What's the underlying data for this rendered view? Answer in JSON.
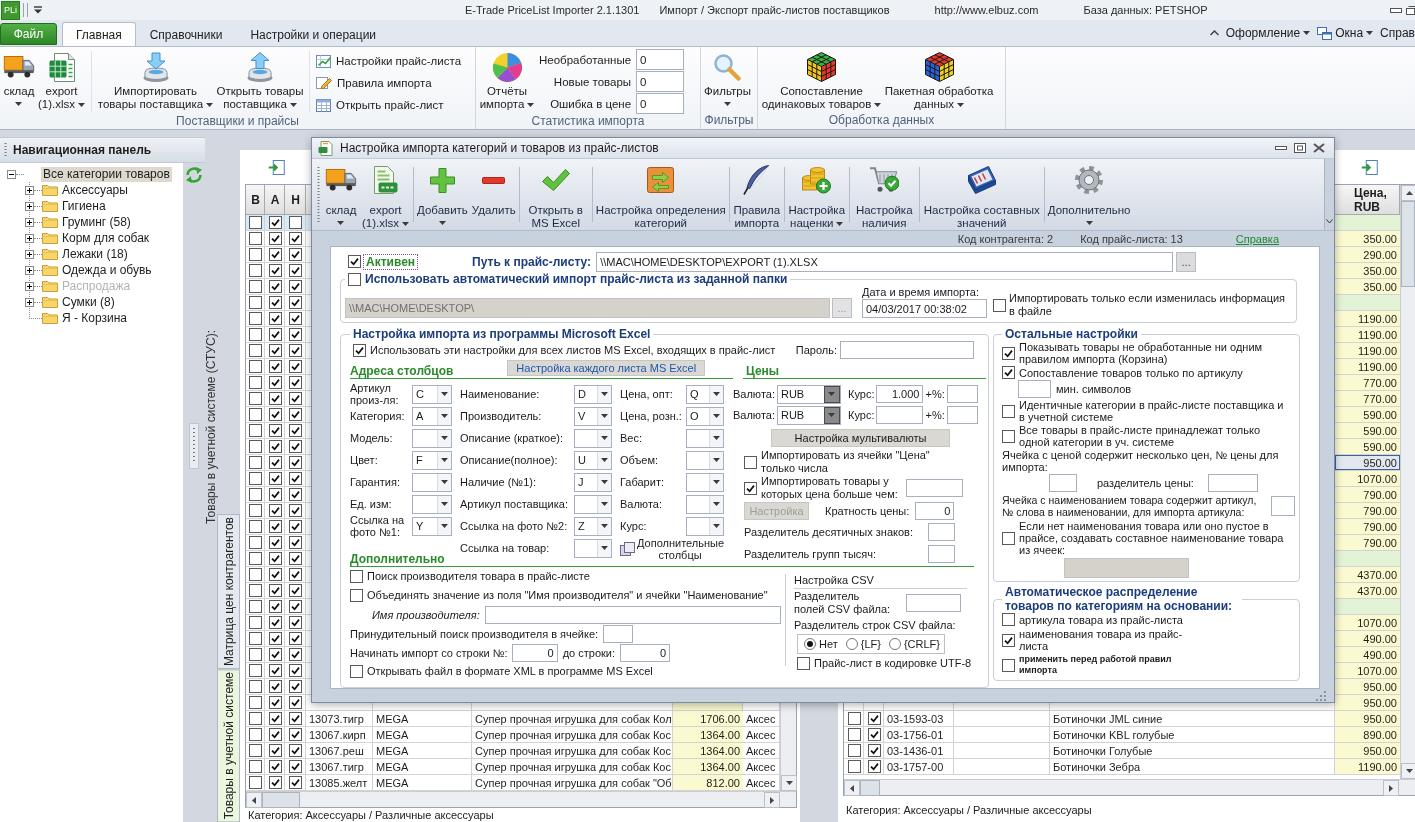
{
  "title_bar": {
    "logo": "PLi",
    "texts": [
      "E-Trade PriceList Importer 2.1.1301",
      "Импорт / Экспорт прайс-листов поставщиков",
      "http://www.elbuz.com",
      "База данных: PETSHOP"
    ]
  },
  "menu_tabs": [
    {
      "label": "Файл",
      "kind": "file",
      "selected": false
    },
    {
      "label": "Главная",
      "kind": "tab",
      "selected": true
    },
    {
      "label": "Справочники",
      "kind": "tab",
      "selected": false
    },
    {
      "label": "Настройки и операции",
      "kind": "tab",
      "selected": false
    }
  ],
  "menu_right": [
    {
      "label": "Оформление",
      "dropdown": true
    },
    {
      "label": "Окна",
      "dropdown": true
    },
    {
      "label": "Справ",
      "dropdown": false
    }
  ],
  "ribbon": {
    "groups": [
      {
        "label": "Поставщики и прайсы",
        "buttons": [
          {
            "label": "склад",
            "dropdown": true
          },
          {
            "label": "export (1).xlsx",
            "dropdown": true
          },
          {
            "label": "Импортировать товары поставщика",
            "dropdown": true
          },
          {
            "label": "Открыть товары поставщика",
            "dropdown": true
          }
        ],
        "small_buttons": [
          "Настройки прайс-листа",
          "Правила импорта",
          "Открыть прайс-лист"
        ]
      },
      {
        "label": "Статистика импорта",
        "buttons": [
          {
            "label": "Отчёты импорта",
            "dropdown": true
          }
        ],
        "stats": [
          {
            "label": "Необработанные",
            "value": "0"
          },
          {
            "label": "Новые товары",
            "value": "0"
          },
          {
            "label": "Ошибка в цене",
            "value": "0"
          }
        ]
      },
      {
        "label": "Фильтры",
        "buttons": [
          {
            "label": "Фильтры",
            "dropdown": true
          }
        ]
      },
      {
        "label": "Обработка данных",
        "buttons": [
          {
            "label": "Сопоставление одинаковых товаров",
            "dropdown": true
          },
          {
            "label": "Пакетная обработка данных",
            "dropdown": true
          }
        ]
      }
    ]
  },
  "navigation": {
    "title": "Навигационная панель",
    "tree": [
      {
        "label": "Все категории товаров",
        "selected": true,
        "disabled": false,
        "expanded": true,
        "children": [
          {
            "label": "Аксессуары",
            "selected": false,
            "disabled": false,
            "expanded": false
          },
          {
            "label": "Гигиена",
            "selected": false,
            "disabled": false,
            "expanded": false
          },
          {
            "label": "Груминг (58)",
            "selected": false,
            "disabled": false,
            "expanded": false
          },
          {
            "label": "Корм для собак",
            "selected": false,
            "disabled": false,
            "expanded": false
          },
          {
            "label": "Лежаки (18)",
            "selected": false,
            "disabled": false,
            "expanded": false
          },
          {
            "label": "Одежда и обувь",
            "selected": false,
            "disabled": false,
            "expanded": false
          },
          {
            "label": "Распродажа",
            "selected": false,
            "disabled": true,
            "expanded": false
          },
          {
            "label": "Сумки (8)",
            "selected": false,
            "disabled": false,
            "expanded": false
          },
          {
            "label": "Я - Корзина",
            "selected": false,
            "disabled": false
          }
        ]
      }
    ]
  },
  "workspace": {
    "caption": "Товары в учетной системе (СТУС):",
    "side_tabs": [
      {
        "label": "Матрица цен контрагентов",
        "selected": false
      },
      {
        "label": "Товары в учетной системе",
        "selected": true
      }
    ]
  },
  "left_grid": {
    "columns": [
      "В",
      "А",
      "Н"
    ],
    "rows": [
      {
        "selected": true,
        "b": false,
        "a": true,
        "h": false
      },
      {
        "selected": false,
        "b": false,
        "a": true,
        "h": true
      },
      {
        "selected": false,
        "b": false,
        "a": true,
        "h": true
      },
      {
        "selected": false,
        "b": false,
        "a": true,
        "h": true
      },
      {
        "selected": false,
        "b": false,
        "a": true,
        "h": true
      },
      {
        "selected": false,
        "b": false,
        "a": true,
        "h": true
      },
      {
        "selected": false,
        "b": false,
        "a": true,
        "h": true
      },
      {
        "selected": false,
        "b": false,
        "a": true,
        "h": true
      },
      {
        "selected": false,
        "b": false,
        "a": true,
        "h": true
      },
      {
        "selected": false,
        "b": false,
        "a": true,
        "h": true
      },
      {
        "selected": false,
        "b": false,
        "a": true,
        "h": true
      },
      {
        "selected": false,
        "b": false,
        "a": true,
        "h": true
      },
      {
        "selected": false,
        "b": false,
        "a": true,
        "h": true
      },
      {
        "selected": false,
        "b": false,
        "a": true,
        "h": true
      },
      {
        "selected": false,
        "b": false,
        "a": true,
        "h": true
      },
      {
        "selected": false,
        "b": false,
        "a": true,
        "h": true
      },
      {
        "selected": false,
        "b": false,
        "a": true,
        "h": true
      },
      {
        "selected": false,
        "b": false,
        "a": true,
        "h": true
      },
      {
        "selected": false,
        "b": false,
        "a": true,
        "h": true
      },
      {
        "selected": false,
        "b": false,
        "a": true,
        "h": true
      },
      {
        "selected": false,
        "b": false,
        "a": true,
        "h": true
      },
      {
        "selected": false,
        "b": false,
        "a": true,
        "h": true
      },
      {
        "selected": false,
        "b": false,
        "a": true,
        "h": true
      },
      {
        "selected": false,
        "b": false,
        "a": true,
        "h": true
      },
      {
        "selected": false,
        "b": false,
        "a": true,
        "h": true
      },
      {
        "selected": false,
        "b": false,
        "a": true,
        "h": true
      },
      {
        "selected": false,
        "b": false,
        "a": true,
        "h": true
      },
      {
        "selected": false,
        "b": false,
        "a": true,
        "h": true
      },
      {
        "selected": false,
        "b": false,
        "a": true,
        "h": true
      },
      {
        "selected": false,
        "b": false,
        "a": true,
        "h": true
      },
      {
        "selected": false,
        "b": false,
        "a": true,
        "h": true
      },
      {
        "selected": false,
        "b": false,
        "a": true,
        "h": true,
        "cells": [
          "13073.тигр",
          "MEGA",
          "Супер прочная игрушка для собак Кол",
          "1706.00",
          "Аксес"
        ]
      },
      {
        "selected": false,
        "b": false,
        "a": true,
        "h": true,
        "cells": [
          "13067.кирп",
          "MEGA",
          "Супер прочная игрушка для собак Кос",
          "1364.00",
          "Аксес"
        ]
      },
      {
        "selected": false,
        "b": false,
        "a": true,
        "h": true,
        "cells": [
          "13067.реш",
          "MEGA",
          "Супер прочная игрушка для собак Кос",
          "1364.00",
          "Аксес"
        ]
      },
      {
        "selected": false,
        "b": false,
        "a": true,
        "h": true,
        "cells": [
          "13067.тигр",
          "MEGA",
          "Супер прочная игрушка для собак Кос",
          "1364.00",
          "Аксес"
        ]
      },
      {
        "selected": false,
        "b": false,
        "a": true,
        "h": true,
        "cells": [
          "13085.желт",
          "MEGA",
          "Супер прочная игрушка для собак \"Об",
          "812.00",
          "Аксес"
        ]
      }
    ],
    "status": "Категория: Аксессуары / Различные аксессуары"
  },
  "right_grid": {
    "price_header": "Цена, RUB",
    "rows": [
      {
        "kind": "group",
        "selected": false
      },
      {
        "kind": "item",
        "selected": false,
        "price": "350.00"
      },
      {
        "kind": "item",
        "selected": false,
        "price": "290.00"
      },
      {
        "kind": "item",
        "selected": false,
        "price": "350.00"
      },
      {
        "kind": "item",
        "selected": false,
        "price": "350.00"
      },
      {
        "kind": "group",
        "selected": false
      },
      {
        "kind": "item",
        "selected": false,
        "price": "1190.00"
      },
      {
        "kind": "item",
        "selected": false,
        "price": "1190.00"
      },
      {
        "kind": "item",
        "selected": false,
        "price": "1190.00"
      },
      {
        "kind": "item",
        "selected": false,
        "price": "1190.00"
      },
      {
        "kind": "item",
        "selected": false,
        "price": "770.00"
      },
      {
        "kind": "item",
        "selected": false,
        "price": "770.00"
      },
      {
        "kind": "item",
        "selected": false,
        "price": "590.00"
      },
      {
        "kind": "item",
        "selected": false,
        "price": "590.00"
      },
      {
        "kind": "item",
        "selected": false,
        "price": "590.00"
      },
      {
        "kind": "item",
        "selected": true,
        "price": "950.00"
      },
      {
        "kind": "item",
        "selected": false,
        "price": "1070.00"
      },
      {
        "kind": "item",
        "selected": false,
        "price": "790.00"
      },
      {
        "kind": "item",
        "selected": false,
        "price": "790.00"
      },
      {
        "kind": "item",
        "selected": false,
        "price": "790.00"
      },
      {
        "kind": "item",
        "selected": false,
        "price": "790.00"
      },
      {
        "kind": "group",
        "selected": false
      },
      {
        "kind": "item",
        "selected": false,
        "price": "4370.00"
      },
      {
        "kind": "item",
        "selected": false,
        "price": "4370.00"
      },
      {
        "kind": "group",
        "selected": false
      },
      {
        "kind": "item",
        "selected": false,
        "price": "1070.00"
      },
      {
        "kind": "item",
        "selected": false,
        "price": "490.00"
      },
      {
        "kind": "item",
        "selected": false,
        "price": "490.00"
      },
      {
        "kind": "item",
        "selected": false,
        "price": "1070.00"
      },
      {
        "kind": "item",
        "selected": false,
        "price": "950.00"
      },
      {
        "kind": "item",
        "selected": false,
        "price": "950.00"
      },
      {
        "kind": "item",
        "selected": false,
        "c1": false,
        "c2": true,
        "article": "03-1593-03",
        "name": "Ботиночки JML синие",
        "price": "950.00"
      },
      {
        "kind": "item",
        "selected": false,
        "c1": false,
        "c2": true,
        "article": "03-1756-01",
        "name": "Ботиночки KBL голубые",
        "price": "890.00"
      },
      {
        "kind": "item",
        "selected": false,
        "c1": false,
        "c2": true,
        "article": "03-1436-01",
        "name": "Ботиночки Голубые",
        "price": "950.00"
      },
      {
        "kind": "item",
        "selected": false,
        "c1": false,
        "c2": true,
        "article": "03-1757-00",
        "name": "Ботиночки Зебра",
        "price": "1190.00"
      }
    ],
    "status": "Категория: Аксессуары / Различные аксессуары"
  },
  "dialog": {
    "title": "Настройка импорта категорий и товаров из прайс-листов",
    "toolbar": [
      {
        "label": "склад",
        "dropdown": true
      },
      {
        "label": "export (1).xlsx",
        "dropdown": true
      },
      {
        "label": "Добавить",
        "dropdown": true
      },
      {
        "label": "Удалить",
        "dropdown": false
      },
      {
        "label": "Открыть в MS Excel",
        "dropdown": false
      },
      {
        "label": "Настройка определения категорий",
        "dropdown": false
      },
      {
        "label": "Правила импорта",
        "dropdown": false
      },
      {
        "label": "Настройка наценки",
        "dropdown": true
      },
      {
        "label": "Настройка наличия",
        "dropdown": false
      },
      {
        "label": "Настройка составных значений",
        "dropdown": false
      },
      {
        "label": "Дополнительно",
        "dropdown": true
      }
    ],
    "info": [
      "Код контрагента: 2",
      "Код прайс-листа: 13"
    ],
    "help_link": "Справка",
    "active": {
      "label": "Активен",
      "checked": true
    },
    "path": {
      "label": "Путь к прайс-листу:",
      "value": "\\\\MAC\\HOME\\DESKTOP\\EXPORT (1).XLSX",
      "button": "..."
    },
    "auto_import": {
      "label": "Использовать автоматический импорт прайс-листа из заданной папки",
      "checked": false,
      "folder": "\\\\MAC\\HOME\\DESKTOP\\",
      "button": "...",
      "date_label": "Дата и время импорта:",
      "date": "04/03/2017 00:38:02",
      "only_changed": {
        "label": "Импортировать только если изменилась информация в файле",
        "checked": false
      }
    },
    "excel": {
      "title": "Настройка импорта из программы Microsoft Excel",
      "use_all": {
        "label": "Использовать эти настройки для всех листов MS Excel, входящих в прайс-лист",
        "checked": true
      },
      "password_label": "Пароль:",
      "sheets_button": "Настройка каждого листа MS Excel",
      "columns_title": "Адреса столбцов",
      "columns": [
        [
          {
            "label": "Артикул произ-ля:",
            "value": "C"
          },
          {
            "label": "Категория:",
            "value": "A"
          },
          {
            "label": "Модель:"
          },
          {
            "label": "Цвет:",
            "value": "F"
          },
          {
            "label": "Гарантия:"
          },
          {
            "label": "Ед. изм:"
          },
          {
            "label": "Ссылка на фото №1:",
            "value": "Y"
          }
        ],
        [
          {
            "label": "Наименование:",
            "value": "D"
          },
          {
            "label": "Производитель:",
            "value": "V"
          },
          {
            "label": "Описание (краткое):"
          },
          {
            "label": "Описание(полное):",
            "value": "U"
          },
          {
            "label": "Наличие (№1):",
            "value": "J"
          },
          {
            "label": "Артикул поставщика:"
          },
          {
            "label": "Ссылка на фото №2:",
            "value": "Z"
          },
          {
            "label": "Ссылка на товар:"
          }
        ],
        [
          {
            "label": "Цена, опт:",
            "value": "Q"
          },
          {
            "label": "Цена, розн.:",
            "value": "O"
          },
          {
            "label": "Вес:"
          },
          {
            "label": "Объем:"
          },
          {
            "label": "Габарит:"
          },
          {
            "label": "Валюта:"
          },
          {
            "label": "Курс:"
          }
        ]
      ],
      "extra_columns": "Дополнительные столбцы",
      "prices_title": "Цены",
      "currencies": [
        {
          "label": "Валюта:",
          "value": "RUB",
          "rate_label": "Курс:",
          "rate": "1.000",
          "percent_label": "+%:"
        },
        {
          "label": "Валюта:",
          "value": "RUB",
          "rate_label": "Курс:",
          "percent_label": "+%:"
        }
      ],
      "multicurrency_button": "Настройка мультивалюты",
      "numbers_only": {
        "label": "Импортировать из ячейки \"Цена\" только числа",
        "checked": false
      },
      "min_price": {
        "label": "Импортировать товары у которых цена больше чем:",
        "checked": true
      },
      "settings_button": {
        "label": "Настройка",
        "disabled": true
      },
      "multiplicity": {
        "label": "Кратность цены:",
        "value": "0"
      },
      "decimal_separator_label": "Разделитель десятичных знаков:",
      "thousands_separator_label": "Разделитель групп тысяч:",
      "additional_title": "Дополнительно",
      "find_maker": {
        "label": "Поиск производителя товара в прайс-листе",
        "checked": false
      },
      "merge_maker": {
        "label": "Объединять значение из поля \"Имя производителя\" и ячейки \"Наименование\"",
        "checked": false
      },
      "maker_name_label": "Имя производителя:",
      "forced_maker_label": "Принудительный поиск производителя в ячейке:",
      "start_row": {
        "label": "Начинать импорт со строки №:",
        "value": "0",
        "end_label": "до строки:",
        "end_value": "0"
      },
      "open_xml": {
        "label": "Открывать файл в формате XML в программе MS Excel",
        "checked": false
      },
      "csv": {
        "title": "Настройка CSV",
        "field_separator_label": "Разделитель полей CSV файла:",
        "row_separator_label": "Разделитель строк CSV файла:",
        "row_separators": [
          {
            "label": "Нет",
            "selected": true
          },
          {
            "label": "{LF}",
            "selected": false
          },
          {
            "label": "{CRLF}",
            "selected": false
          }
        ],
        "utf8": {
          "label": "Прайс-лист в кодировке UTF-8",
          "checked": false
        }
      }
    },
    "other": {
      "title": "Остальные настройки",
      "show_unprocessed": {
        "label": "Показывать товары не обработанные ни одним правилом импорта (Корзина)",
        "checked": true
      },
      "match_by_article": {
        "label": "Сопоставление товаров только по артикулу",
        "checked": true
      },
      "min_chars_label": "мин. символов",
      "identical_categories": {
        "label": "Идентичные категории в прайс-листе поставщика и в учетной системе",
        "checked": false
      },
      "single_category": {
        "label": "Все товары в прайс-листе принадлежат только одной категории в уч. системе",
        "checked": false
      },
      "multi_price_label": "Ячейка с ценой содержит несколько цен, № цены для импорта:",
      "price_separator_label": "разделитель цены:",
      "article_in_name_label": "Ячейка с наименованием товара содержит артикул, № слова в наименовании, для импорта артикула:",
      "compose_name": {
        "label": "Если нет наименования товара или оно пустое в прайсе, создавать составное наименование товара из ячеек:",
        "checked": false
      }
    },
    "auto_distribution": {
      "title": "Автоматическое распределение товаров по категориям на основании:",
      "options": [
        {
          "label": "артикула товара из прайс-листа",
          "checked": false,
          "kind": "normal"
        },
        {
          "label": "наименования товара из прайс-листа",
          "checked": true,
          "kind": "normal"
        },
        {
          "label": "применить перед работой правил импорта",
          "checked": false,
          "kind": "small"
        }
      ]
    }
  }
}
